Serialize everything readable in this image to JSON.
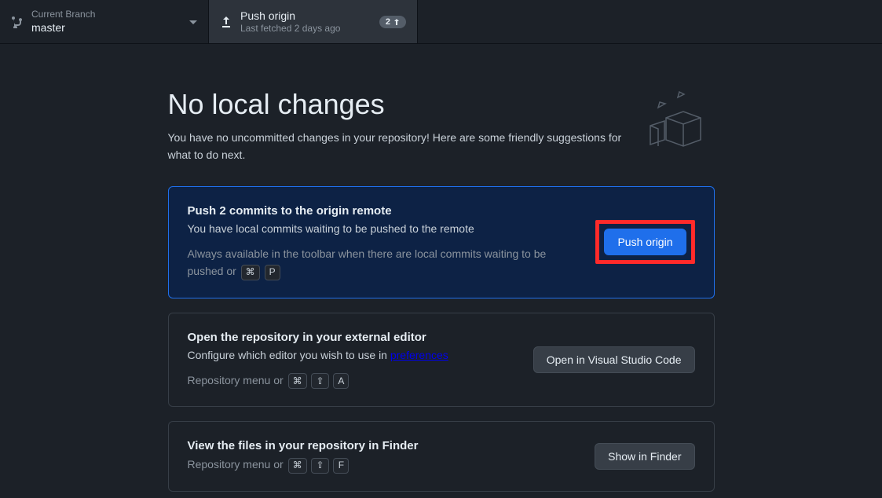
{
  "toolbar": {
    "branch": {
      "label": "Current Branch",
      "value": "master"
    },
    "push": {
      "title": "Push origin",
      "subtitle": "Last fetched 2 days ago",
      "badge_count": "2"
    }
  },
  "header": {
    "title": "No local changes",
    "subtitle": "You have no uncommitted changes in your repository! Here are some friendly suggestions for what to do next."
  },
  "cards": {
    "push": {
      "title": "Push 2 commits to the origin remote",
      "desc": "You have local commits waiting to be pushed to the remote",
      "hint_prefix": "Always available in the toolbar when there are local commits waiting to be pushed or ",
      "kbd1": "⌘",
      "kbd2": "P",
      "button": "Push origin"
    },
    "editor": {
      "title": "Open the repository in your external editor",
      "desc_prefix": "Configure which editor you wish to use in ",
      "desc_link": "preferences",
      "hint_prefix": "Repository menu or ",
      "kbd1": "⌘",
      "kbd2": "⇧",
      "kbd3": "A",
      "button": "Open in Visual Studio Code"
    },
    "finder": {
      "title": "View the files in your repository in Finder",
      "hint_prefix": "Repository menu or ",
      "kbd1": "⌘",
      "kbd2": "⇧",
      "kbd3": "F",
      "button": "Show in Finder"
    }
  }
}
